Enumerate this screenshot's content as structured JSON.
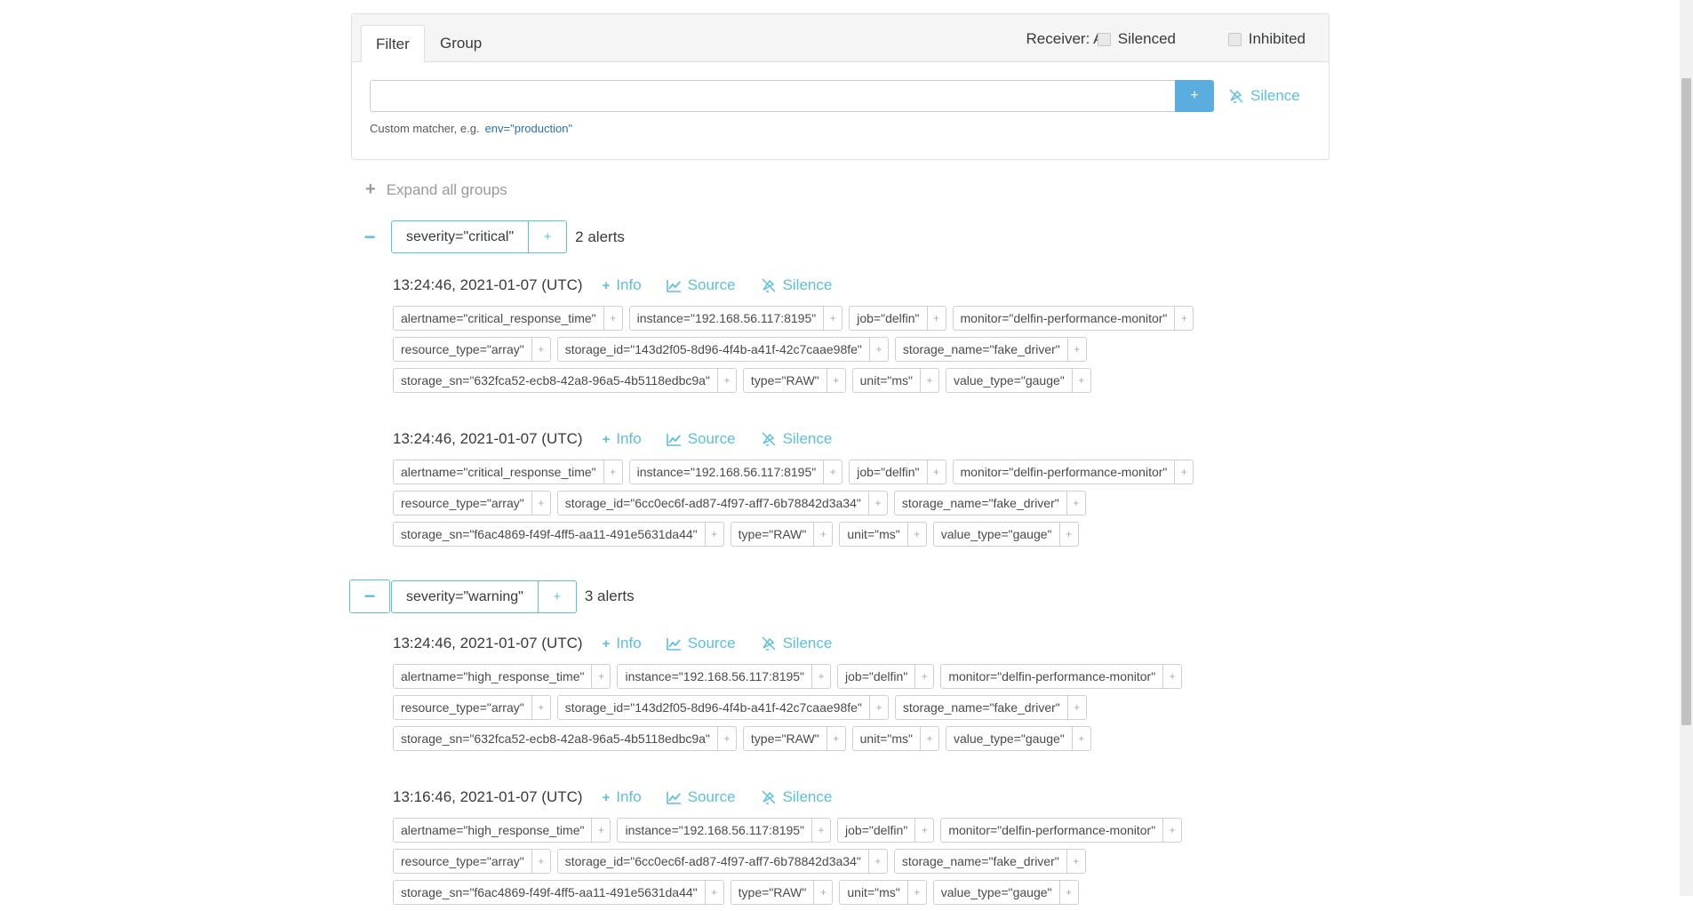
{
  "filter": {
    "tabs": [
      "Filter",
      "Group"
    ],
    "receiver": "Receiver: All",
    "silenced_label": "Silenced",
    "inhibited_label": "Inhibited",
    "input_value": "",
    "add_label": "+",
    "silence_label": "Silence",
    "hint_text": "Custom matcher, e.g.",
    "hint_example": "env=\"production\""
  },
  "expand_all": "Expand all groups",
  "groups": [
    {
      "label": "severity=\"critical\"",
      "count": "2 alerts",
      "alerts": [
        {
          "time": "13:24:46, 2021-01-07 (UTC)",
          "rows": [
            [
              "alertname=\"critical_response_time\"",
              "instance=\"192.168.56.117:8195\"",
              "job=\"delfin\"",
              "monitor=\"delfin-performance-monitor\""
            ],
            [
              "resource_type=\"array\"",
              "storage_id=\"143d2f05-8d96-4f4b-a41f-42c7caae98fe\"",
              "storage_name=\"fake_driver\""
            ],
            [
              "storage_sn=\"632fca52-ecb8-42a8-96a5-4b5118edbc9a\"",
              "type=\"RAW\"",
              "unit=\"ms\"",
              "value_type=\"gauge\""
            ]
          ]
        },
        {
          "time": "13:24:46, 2021-01-07 (UTC)",
          "rows": [
            [
              "alertname=\"critical_response_time\"",
              "instance=\"192.168.56.117:8195\"",
              "job=\"delfin\"",
              "monitor=\"delfin-performance-monitor\""
            ],
            [
              "resource_type=\"array\"",
              "storage_id=\"6cc0ec6f-ad87-4f97-aff7-6b78842d3a34\"",
              "storage_name=\"fake_driver\""
            ],
            [
              "storage_sn=\"f6ac4869-f49f-4ff5-aa11-491e5631da44\"",
              "type=\"RAW\"",
              "unit=\"ms\"",
              "value_type=\"gauge\""
            ]
          ]
        }
      ]
    },
    {
      "label": "severity=\"warning\"",
      "count": "3 alerts",
      "alerts": [
        {
          "time": "13:24:46, 2021-01-07 (UTC)",
          "rows": [
            [
              "alertname=\"high_response_time\"",
              "instance=\"192.168.56.117:8195\"",
              "job=\"delfin\"",
              "monitor=\"delfin-performance-monitor\""
            ],
            [
              "resource_type=\"array\"",
              "storage_id=\"143d2f05-8d96-4f4b-a41f-42c7caae98fe\"",
              "storage_name=\"fake_driver\""
            ],
            [
              "storage_sn=\"632fca52-ecb8-42a8-96a5-4b5118edbc9a\"",
              "type=\"RAW\"",
              "unit=\"ms\"",
              "value_type=\"gauge\""
            ]
          ]
        },
        {
          "time": "13:16:46, 2021-01-07 (UTC)",
          "rows": [
            [
              "alertname=\"high_response_time\"",
              "instance=\"192.168.56.117:8195\"",
              "job=\"delfin\"",
              "monitor=\"delfin-performance-monitor\""
            ],
            [
              "resource_type=\"array\"",
              "storage_id=\"6cc0ec6f-ad87-4f97-aff7-6b78842d3a34\"",
              "storage_name=\"fake_driver\""
            ],
            [
              "storage_sn=\"f6ac4869-f49f-4ff5-aa11-491e5631da44\"",
              "type=\"RAW\"",
              "unit=\"ms\"",
              "value_type=\"gauge\""
            ]
          ]
        }
      ]
    }
  ],
  "alert_actions": {
    "info": "Info",
    "source": "Source",
    "silence": "Silence"
  },
  "colors": {
    "accent": "#5bc0de",
    "button": "#5bacdf"
  }
}
